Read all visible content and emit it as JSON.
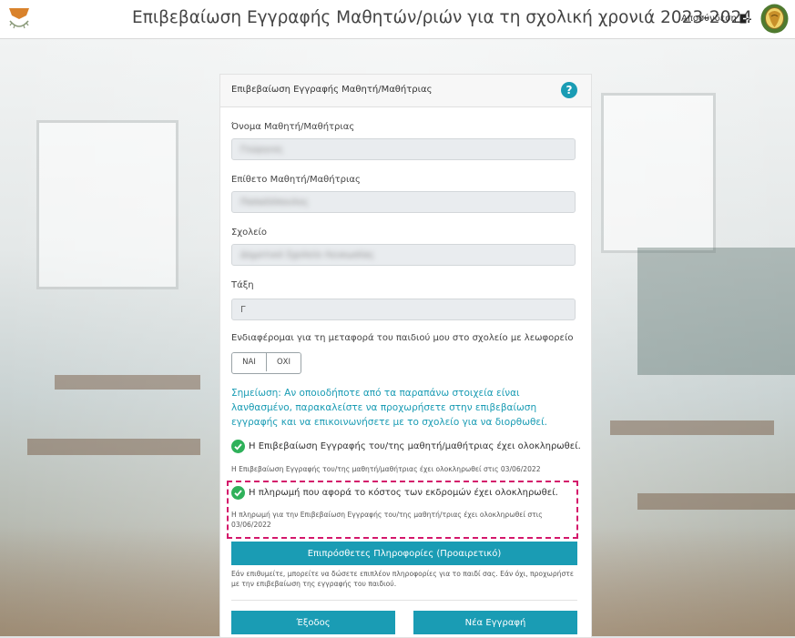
{
  "header": {
    "title": "Επιβεβαίωση Εγγραφής Μαθητών/ριών για τη σχολική χρονιά 2023-2024",
    "logout_label": "Αποσύνδεση",
    "icons": {
      "logo_left": "cyprus-map-logo-icon",
      "logout": "logout-icon",
      "logo_right": "cyprus-emblem-icon"
    }
  },
  "card": {
    "title": "Επιβεβαίωση Εγγραφής Μαθητή/Μαθήτριας",
    "help_icon": "?"
  },
  "form": {
    "first_name_label": "Όνομα Μαθητή/Μαθήτριας",
    "first_name_value": "Γεώργιος",
    "last_name_label": "Επίθετο Μαθητή/Μαθήτριας",
    "last_name_value": "Παπαδόπουλος",
    "school_label": "Σχολείο",
    "school_value": "Δημοτικό Σχολείο Λευκωσίας",
    "class_label": "Τάξη",
    "class_value": "Γ",
    "bus_label": "Ενδιαφέρομαι για τη μεταφορά του παιδιού μου στο σχολείο με λεωφορείο",
    "bus_yes": "ΝΑΙ",
    "bus_no": "ΟΧΙ"
  },
  "note": "Σημείωση: Αν οποιοδήποτε από τα παραπάνω στοιχεία είναι λανθασμένο, παρακαλείστε να προχωρήσετε στην επιβεβαίωση εγγραφής και να επικοινωνήσετε με το σχολείο για να διορθωθεί.",
  "status": {
    "registration_done": "Η Επιβεβαίωση Εγγραφής του/της μαθητή/μαθήτριας έχει ολοκληρωθεί.",
    "registration_date": "Η Επιβεβαίωση Εγγραφής του/της μαθητή/μαθήτριας έχει ολοκληρωθεί στις 03/06/2022",
    "payment_done": "Η πληρωμή που αφορά το κόστος των εκδρομών έχει ολοκληρωθεί.",
    "payment_date": "Η πληρωμή για την Επιβεβαίωση Εγγραφής του/της μαθητή/τριας έχει ολοκληρωθεί στις 03/06/2022"
  },
  "extra": {
    "button_label": "Επιπρόσθετες Πληροφορίες (Προαιρετικό)",
    "hint": "Εάν επιθυμείτε, μπορείτε να δώσετε επιπλέον πληροφορίες για το παιδί σας. Εάν όχι, προχωρήστε με την επιβεβαίωση της εγγραφής του παιδιού."
  },
  "actions": {
    "exit_label": "Έξοδος",
    "new_label": "Νέα Εγγραφή"
  },
  "colors": {
    "accent": "#1a9cb4",
    "success": "#2fb15a",
    "highlight": "#d4186b"
  }
}
